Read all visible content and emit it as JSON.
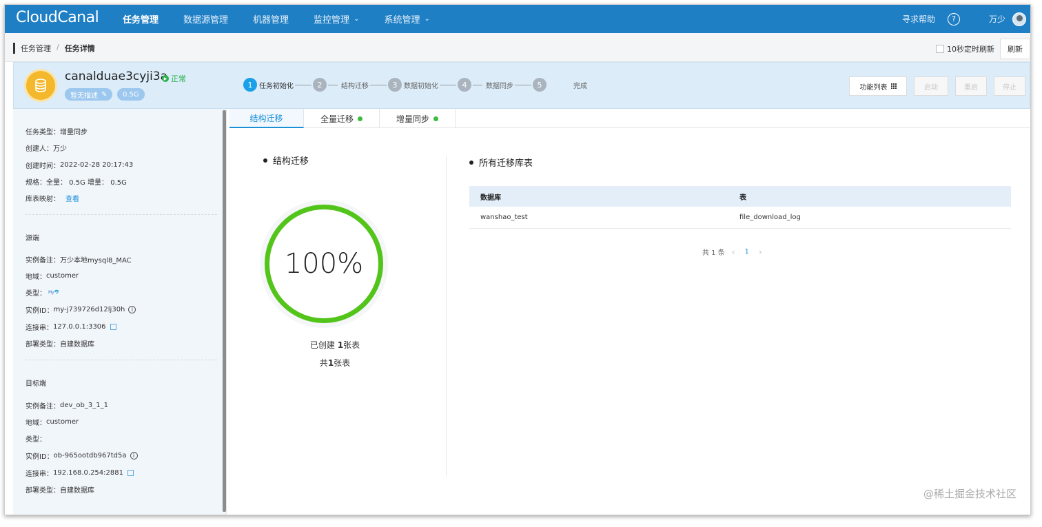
{
  "topnav": {
    "logo": "CloudCanal",
    "items": [
      {
        "label": "任务管理",
        "active": true,
        "dropdown": false
      },
      {
        "label": "数据源管理",
        "active": false,
        "dropdown": false
      },
      {
        "label": "机器管理",
        "active": false,
        "dropdown": false
      },
      {
        "label": "监控管理",
        "active": false,
        "dropdown": true
      },
      {
        "label": "系统管理",
        "active": false,
        "dropdown": true
      }
    ],
    "help": "寻求帮助",
    "help_icon": "?",
    "user": "万少",
    "caret": "⌄"
  },
  "breadcrumb": {
    "items": [
      "任务管理",
      "任务详情"
    ],
    "separator": "/"
  },
  "refresh": {
    "auto_label": "10秒定时刷新",
    "button": "刷新"
  },
  "task": {
    "name": "canalduae3cyji3a",
    "status": "正常",
    "desc_tag": "暂无描述",
    "size_tag": "0.5G",
    "steps": [
      {
        "num": "1",
        "label": "任务初始化",
        "active": true
      },
      {
        "num": "2",
        "label": "结构迁移",
        "active": false
      },
      {
        "num": "3",
        "label": "数据初始化",
        "active": false
      },
      {
        "num": "4",
        "label": "数据同步",
        "active": false
      },
      {
        "num": "5",
        "label": "完成",
        "active": false
      }
    ],
    "actions": {
      "function_list": "功能列表",
      "start": "启动",
      "restart": "重启",
      "stop": "停止"
    }
  },
  "left": {
    "general": [
      {
        "label": "任务类型：",
        "value": "增量同步"
      },
      {
        "label": "创建人：",
        "value": "万少"
      },
      {
        "label": "创建时间：",
        "value": "2022-02-28 20:17:43"
      },
      {
        "label": "规格：",
        "value": "全量： 0.5G 增量： 0.5G"
      },
      {
        "label": "库表映射：",
        "value": "查看"
      }
    ],
    "source_title": "源端",
    "source": {
      "remark_label": "实例备注：",
      "remark": "万少本地mysql8_MAC",
      "region_label": "地域：",
      "region": "customer",
      "type_label": "类型：",
      "type_icon": "mysql",
      "id_label": "实例ID：",
      "id": "my-j739726d12lj30h",
      "conn_label": "连接串：",
      "conn": "127.0.0.1:3306",
      "deploy_label": "部署类型：",
      "deploy": "自建数据库"
    },
    "target_title": "目标端",
    "target": {
      "remark_label": "实例备注：",
      "remark": "dev_ob_3_1_1",
      "region_label": "地域：",
      "region": "customer",
      "type_label": "类型：",
      "id_label": "实例ID：",
      "id": "ob-965ootdb967td5a",
      "conn_label": "连接串：",
      "conn": "192.168.0.254:2881",
      "deploy_label": "部署类型：",
      "deploy": "自建数据库"
    }
  },
  "tabs": [
    {
      "label": "结构迁移",
      "active": true,
      "dot": false
    },
    {
      "label": "全量迁移",
      "active": false,
      "dot": true
    },
    {
      "label": "增量同步",
      "active": false,
      "dot": true
    }
  ],
  "structure": {
    "title": "结构迁移",
    "progress": "100%",
    "created_prefix": "已创建 ",
    "created_count": "1",
    "created_suffix": "张表",
    "total_prefix": "共",
    "total_count": "1",
    "total_suffix": "张表"
  },
  "migrated": {
    "title": "所有迁移库表",
    "columns": [
      "数据库",
      "表"
    ],
    "rows": [
      [
        "wanshao_test",
        "file_download_log"
      ]
    ],
    "pager_total": "共 1 条",
    "pager_page": "1",
    "prev": "‹",
    "next": "›"
  },
  "watermark": "@稀土掘金技术社区",
  "colors": {
    "nav_bg": "#1f7fc5",
    "accent": "#1a90d9",
    "success": "#52c41a"
  }
}
